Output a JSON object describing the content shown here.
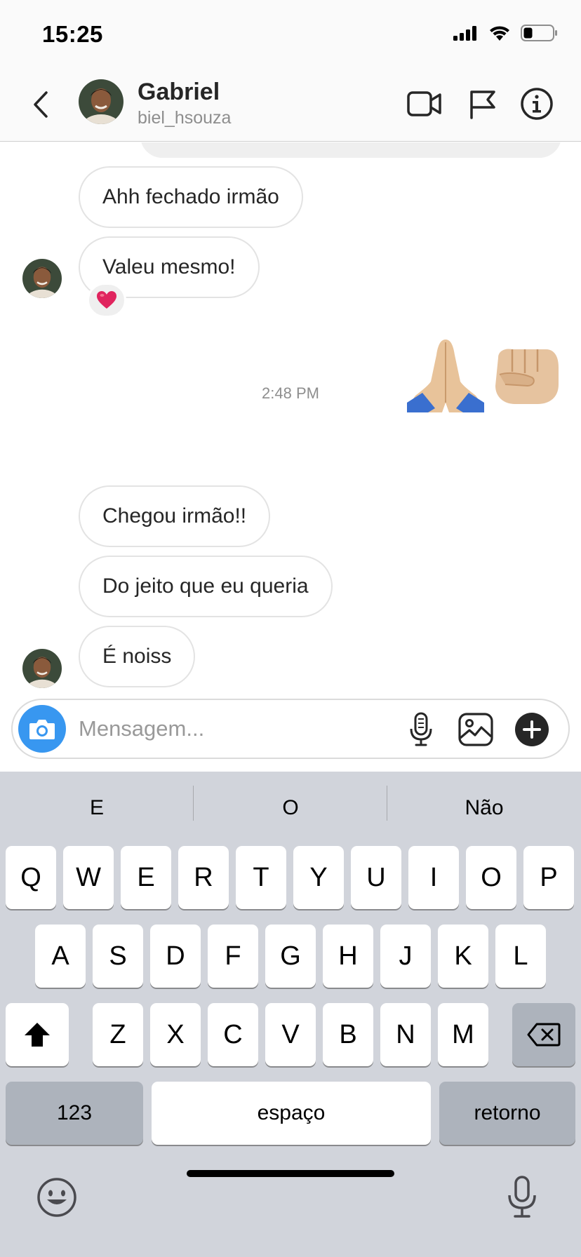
{
  "status_bar": {
    "time": "15:25",
    "icons": [
      "cellular-signal-icon",
      "wifi-icon",
      "battery-icon"
    ]
  },
  "header": {
    "name": "Gabriel",
    "username": "biel_hsouza",
    "icons": [
      "back-icon",
      "video-call-icon",
      "flag-icon",
      "info-icon"
    ]
  },
  "messages": [
    {
      "text": "Ahh fechado irmão",
      "sender": "Gabriel"
    },
    {
      "text": "Valeu mesmo!",
      "sender": "Gabriel",
      "reaction": "❤️"
    },
    {
      "emoji": "🙏🏼👊🏼",
      "sender": "me"
    },
    {
      "timestamp": "2:48 PM"
    },
    {
      "text": "Chegou irmão!!",
      "sender": "Gabriel"
    },
    {
      "text": "Do jeito que eu queria",
      "sender": "Gabriel"
    },
    {
      "text": "É noiss",
      "sender": "Gabriel"
    }
  ],
  "chat": {
    "msg1": "Ahh fechado irmão",
    "msg2": "Valeu mesmo!",
    "msg2_reaction": "❤️",
    "emoji1": "🙏🏼",
    "emoji2": "👊🏼",
    "timestamp": "2:48 PM",
    "msg3": "Chegou irmão!!",
    "msg4": "Do jeito que eu queria",
    "msg5": "É noiss"
  },
  "composer": {
    "placeholder": "Mensagem...",
    "value": "",
    "icons": [
      "camera-icon",
      "microphone-icon",
      "gallery-icon",
      "add-icon"
    ]
  },
  "keyboard": {
    "suggestions": [
      "E",
      "O",
      "Não"
    ],
    "row1": [
      "Q",
      "W",
      "E",
      "R",
      "T",
      "Y",
      "U",
      "I",
      "O",
      "P"
    ],
    "row2": [
      "A",
      "S",
      "D",
      "F",
      "G",
      "H",
      "J",
      "K",
      "L"
    ],
    "row3": [
      "Z",
      "X",
      "C",
      "V",
      "B",
      "N",
      "M"
    ],
    "numbers_key": "123",
    "space_key": "espaço",
    "return_key": "retorno",
    "icons": [
      "shift-icon",
      "backspace-icon",
      "emoji-icon",
      "dictation-icon"
    ]
  },
  "colors": {
    "accent": "#3897f0",
    "bubble_border": "#e3e3e3",
    "keyboard_bg": "#d1d4db",
    "reaction_heart": "#e0245e"
  }
}
